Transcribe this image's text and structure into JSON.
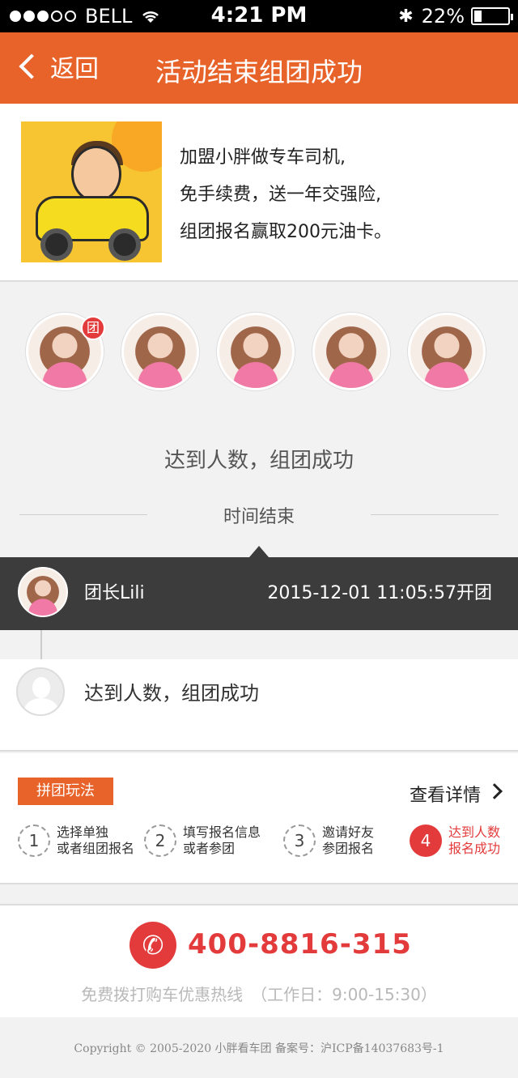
{
  "status_bar": {
    "carrier": "BELL",
    "time": "4:21 PM",
    "battery_text": "22%",
    "battery_level": 0.22,
    "signal_dots_filled": 3,
    "signal_dots_total": 5
  },
  "nav": {
    "back_label": "返回",
    "title": "活动结束组团成功"
  },
  "promo": {
    "image_name": "driver-car-illustration",
    "line1": "加盟小胖做专车司机,",
    "line2": "免手续费，送一年交强险,",
    "line3": "组团报名赢取200元油卡。"
  },
  "members": {
    "count": 5,
    "leader_badge": "团",
    "success_text": "达到人数，组团成功",
    "time_end_text": "时间结束"
  },
  "leader": {
    "name": "团长Lili",
    "time": "2015-12-01 11:05:57开团"
  },
  "status_row": {
    "text": "达到人数，组团成功"
  },
  "rules": {
    "tag": "拼团玩法",
    "more_label": "查看详情",
    "steps": [
      {
        "num": "1",
        "line1": "选择单独",
        "line2": "或者组团报名"
      },
      {
        "num": "2",
        "line1": "填写报名信息",
        "line2": "或者参团"
      },
      {
        "num": "3",
        "line1": "邀请好友",
        "line2": "参团报名"
      },
      {
        "num": "4",
        "line1": "达到人数",
        "line2": "报名成功"
      }
    ]
  },
  "hotline": {
    "number": "400-8816-315",
    "sub": "免费拨打购车优惠热线　（工作日：9:00-15:30）"
  },
  "footer": {
    "copyright": "Copyright © 2005-2020 小胖看车团 备案号：沪ICP备14037683号-1"
  },
  "colors": {
    "brand_orange": "#e8632a",
    "accent_red": "#e33b3b",
    "dark_bar": "#3c3c3c"
  }
}
